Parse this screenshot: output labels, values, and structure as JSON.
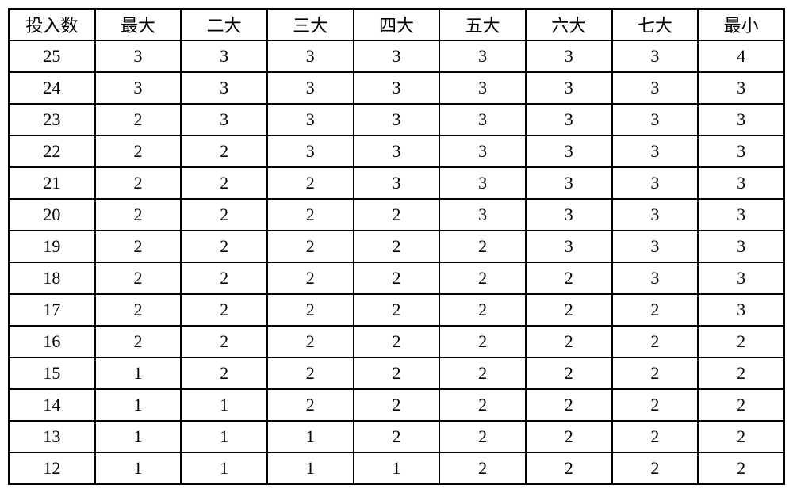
{
  "table": {
    "headers": [
      "投入数",
      "最大",
      "二大",
      "三大",
      "四大",
      "五大",
      "六大",
      "七大",
      "最小"
    ],
    "rows": [
      [
        "25",
        "3",
        "3",
        "3",
        "3",
        "3",
        "3",
        "3",
        "4"
      ],
      [
        "24",
        "3",
        "3",
        "3",
        "3",
        "3",
        "3",
        "3",
        "3"
      ],
      [
        "23",
        "2",
        "3",
        "3",
        "3",
        "3",
        "3",
        "3",
        "3"
      ],
      [
        "22",
        "2",
        "2",
        "3",
        "3",
        "3",
        "3",
        "3",
        "3"
      ],
      [
        "21",
        "2",
        "2",
        "2",
        "3",
        "3",
        "3",
        "3",
        "3"
      ],
      [
        "20",
        "2",
        "2",
        "2",
        "2",
        "3",
        "3",
        "3",
        "3"
      ],
      [
        "19",
        "2",
        "2",
        "2",
        "2",
        "2",
        "3",
        "3",
        "3"
      ],
      [
        "18",
        "2",
        "2",
        "2",
        "2",
        "2",
        "2",
        "3",
        "3"
      ],
      [
        "17",
        "2",
        "2",
        "2",
        "2",
        "2",
        "2",
        "2",
        "3"
      ],
      [
        "16",
        "2",
        "2",
        "2",
        "2",
        "2",
        "2",
        "2",
        "2"
      ],
      [
        "15",
        "1",
        "2",
        "2",
        "2",
        "2",
        "2",
        "2",
        "2"
      ],
      [
        "14",
        "1",
        "1",
        "2",
        "2",
        "2",
        "2",
        "2",
        "2"
      ],
      [
        "13",
        "1",
        "1",
        "1",
        "2",
        "2",
        "2",
        "2",
        "2"
      ],
      [
        "12",
        "1",
        "1",
        "1",
        "1",
        "2",
        "2",
        "2",
        "2"
      ]
    ]
  }
}
